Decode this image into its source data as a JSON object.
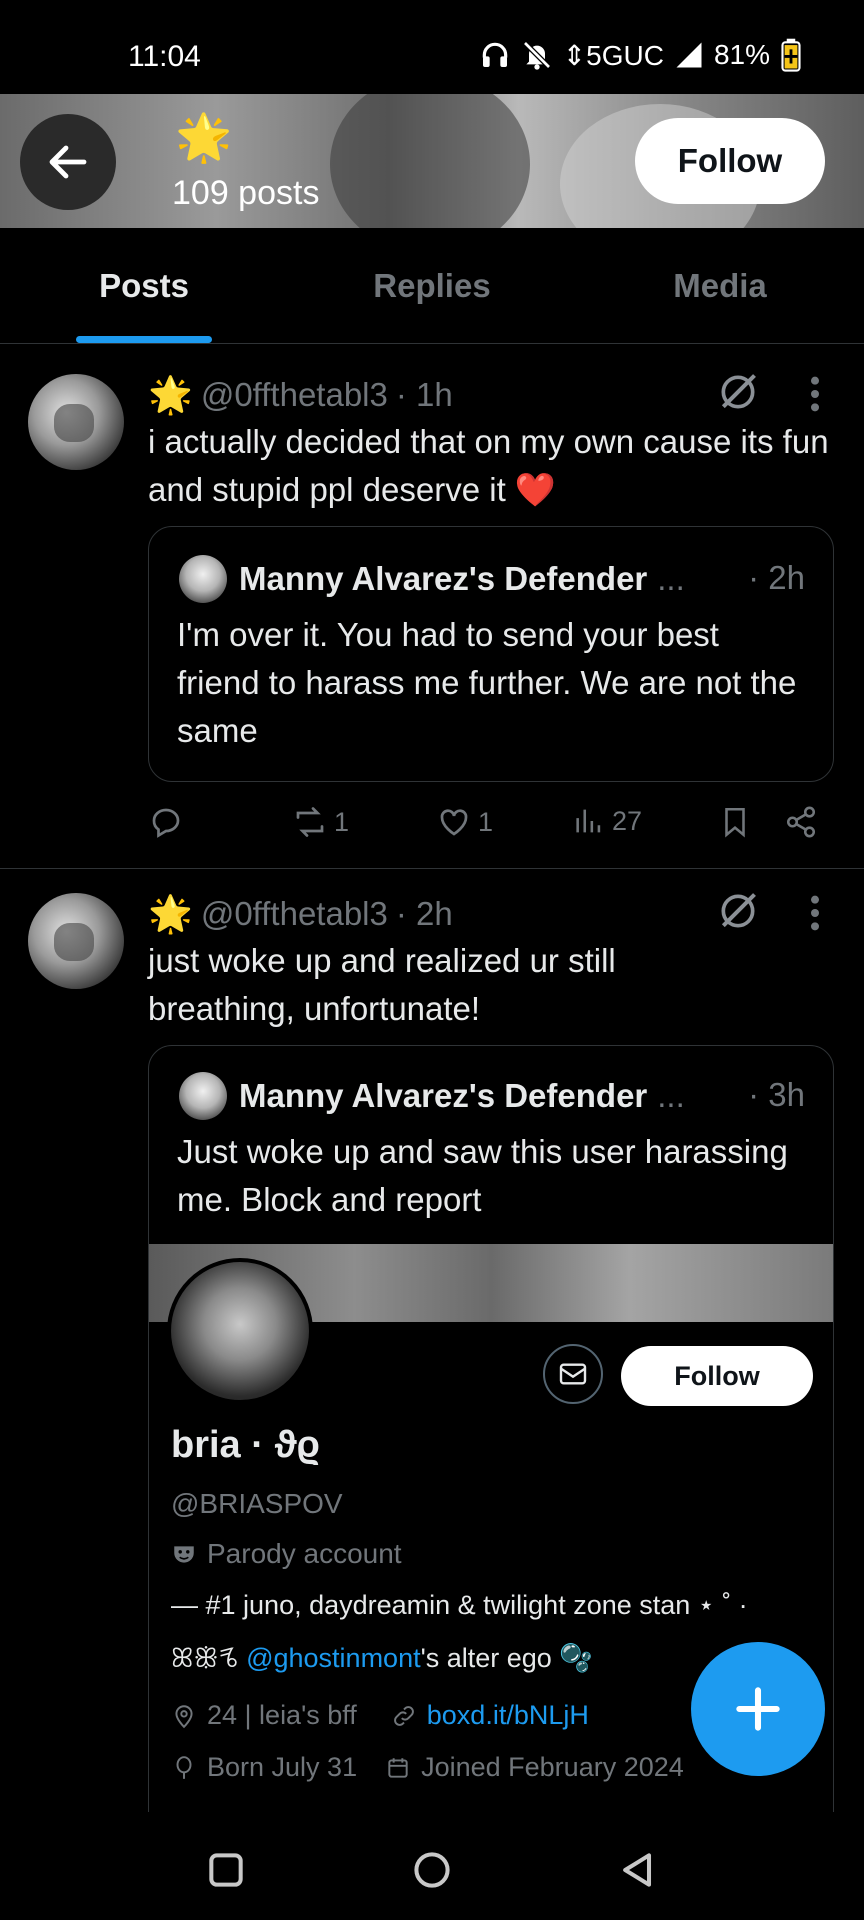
{
  "status_bar": {
    "time": "11:04",
    "network": "5GUC",
    "battery": "81%"
  },
  "header": {
    "emoji": "🌟",
    "post_count": "109 posts",
    "follow_label": "Follow"
  },
  "tabs": [
    {
      "label": "Posts",
      "active": true
    },
    {
      "label": "Replies",
      "active": false
    },
    {
      "label": "Media",
      "active": false
    }
  ],
  "posts": [
    {
      "emoji": "🌟",
      "handle": "@0ffthetabl3",
      "time": "· 1h",
      "text": "i actually decided that on my own cause its fun and stupid ppl deserve it ❤️",
      "quote": {
        "name": "Manny Alvarez's Defender",
        "ellipsis": "...",
        "time": "· 2h",
        "text": "I'm over it. You had to send your best friend to harass me further. We are not the same"
      },
      "actions": {
        "replies": "",
        "reposts": "1",
        "likes": "1",
        "views": "27"
      }
    },
    {
      "emoji": "🌟",
      "handle": "@0ffthetabl3",
      "time": "· 2h",
      "text": "just woke up and realized ur still breathing, unfortunate!",
      "quote": {
        "name": "Manny Alvarez's Defender",
        "ellipsis": "...",
        "time": "· 3h",
        "text": "Just woke up and saw this user harassing me. Block and report",
        "profile_card": {
          "follow_label": "Follow",
          "name": "bria · ϑϱ",
          "handle": "@BRIASPOV",
          "parody": "Parody account",
          "bio_line1": "— #1 juno, daydreamin & twilight zone stan ⋆ ˚ ·",
          "bio_prefix": "ꕤꕥꕦ ",
          "bio_mention": "@ghostinmont",
          "bio_suffix": "'s alter ego 🫧",
          "location": "24 | leia's bff",
          "link": "boxd.it/bNLjH",
          "born": "Born July 31",
          "joined": "Joined February 2024"
        }
      }
    }
  ],
  "colors": {
    "accent": "#1d9bf0",
    "muted": "#71767b",
    "border": "#2f3336",
    "text": "#e7e9ea"
  }
}
